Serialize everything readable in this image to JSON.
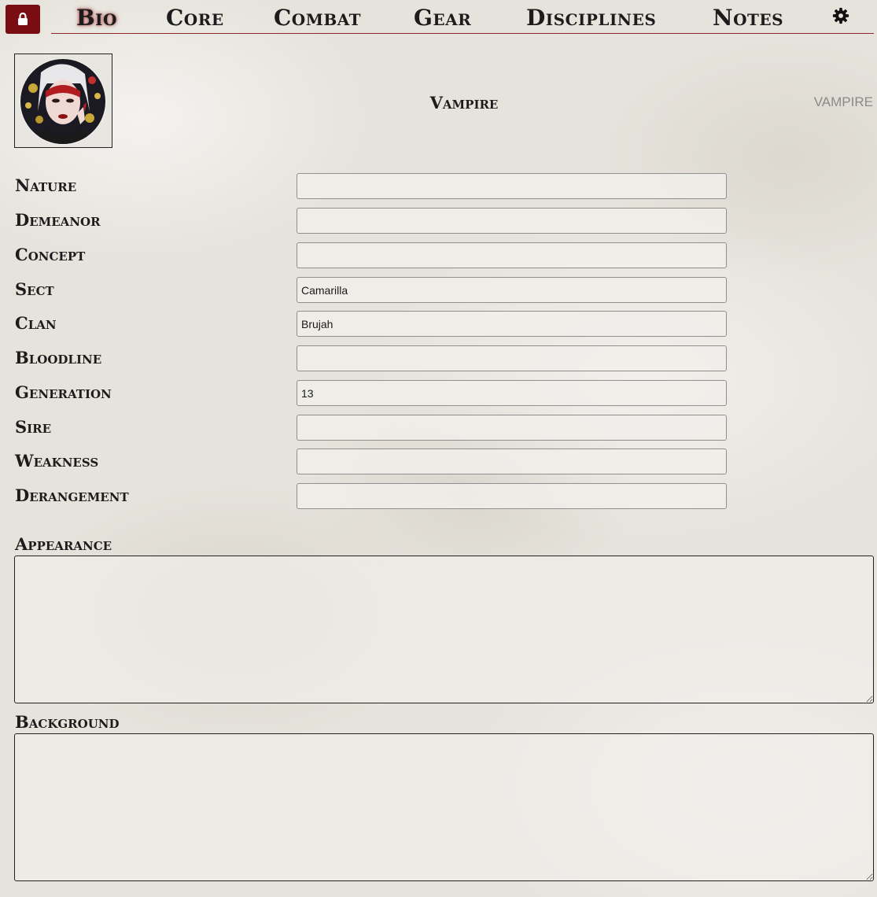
{
  "nav": {
    "lock_icon": "lock-icon",
    "tabs": [
      {
        "label": "Bio",
        "active": true
      },
      {
        "label": "Core",
        "active": false
      },
      {
        "label": "Combat",
        "active": false
      },
      {
        "label": "Gear",
        "active": false
      },
      {
        "label": "Disciplines",
        "active": false
      },
      {
        "label": "Notes",
        "active": false
      }
    ],
    "settings_icon": "gear-icon"
  },
  "header": {
    "sheet_type": "Vampire",
    "tag": "VAMPIRE"
  },
  "fields": [
    {
      "label": "Nature",
      "value": ""
    },
    {
      "label": "Demeanor",
      "value": ""
    },
    {
      "label": "Concept",
      "value": ""
    },
    {
      "label": "Sect",
      "value": "Camarilla"
    },
    {
      "label": "Clan",
      "value": "Brujah"
    },
    {
      "label": "Bloodline",
      "value": ""
    },
    {
      "label": "Generation",
      "value": "13"
    },
    {
      "label": "Sire",
      "value": ""
    },
    {
      "label": "Weakness",
      "value": ""
    },
    {
      "label": "Derangement",
      "value": ""
    }
  ],
  "appearance": {
    "label": "Appearance",
    "value": ""
  },
  "background": {
    "label": "Background",
    "value": ""
  },
  "colors": {
    "accent": "#7a0d12",
    "divider": "#8a2a2a",
    "parchment": "#e6e3dc"
  }
}
